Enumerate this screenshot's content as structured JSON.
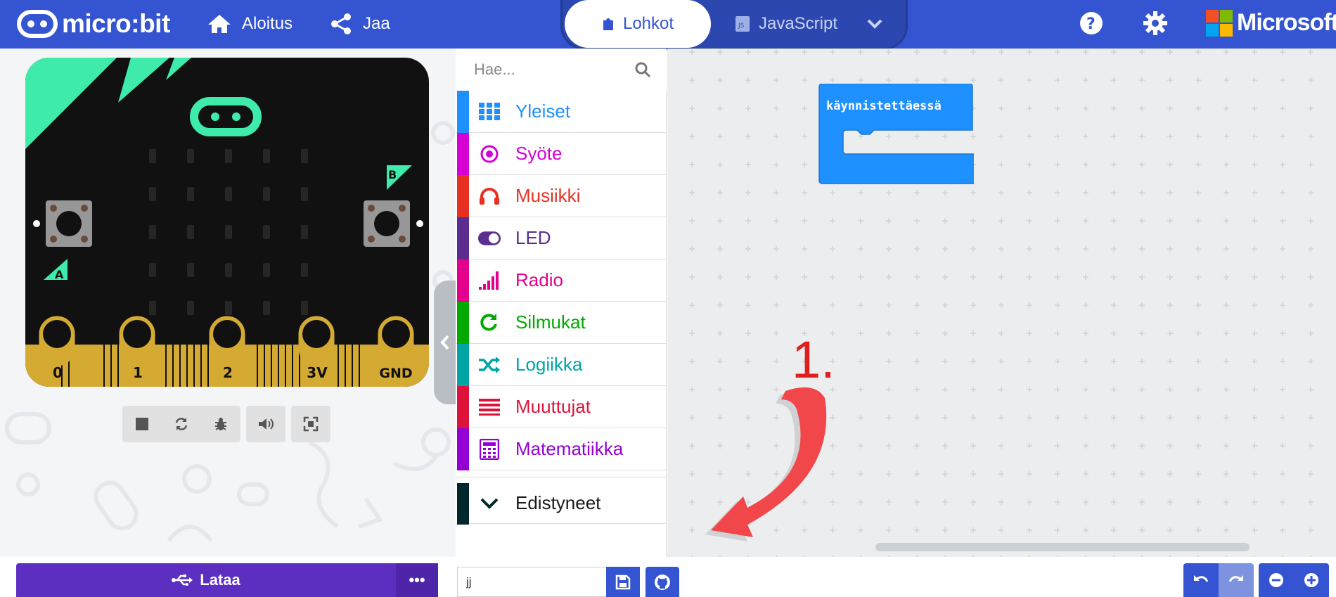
{
  "header": {
    "logo_text": "micro:bit",
    "nav": [
      {
        "label": "Aloitus",
        "icon": "home-icon"
      },
      {
        "label": "Jaa",
        "icon": "share-icon"
      }
    ],
    "modes": {
      "blocks_label": "Lohkot",
      "javascript_label": "JavaScript",
      "active": "Lohkot"
    },
    "right_icons": [
      "help-icon",
      "settings-icon"
    ],
    "brand": "Microsoft",
    "color": "#3454d1"
  },
  "simulator": {
    "pins": [
      "0",
      "1",
      "2",
      "3V",
      "GND"
    ],
    "buttons": [
      "A",
      "B"
    ],
    "controls": [
      "stop-icon",
      "restart-icon",
      "debug-icon",
      "mute-icon",
      "fullscreen-icon"
    ]
  },
  "toolbox": {
    "search_placeholder": "Hae...",
    "categories": [
      {
        "label": "Yleiset",
        "color": "#1e90ff",
        "icon": "grid-icon"
      },
      {
        "label": "Syöte",
        "color": "#d400d4",
        "icon": "target-icon"
      },
      {
        "label": "Musiikki",
        "color": "#e63022",
        "icon": "headphones-icon"
      },
      {
        "label": "LED",
        "color": "#5c2d91",
        "icon": "toggle-icon"
      },
      {
        "label": "Radio",
        "color": "#e3008c",
        "icon": "signal-icon"
      },
      {
        "label": "Silmukat",
        "color": "#00aa00",
        "icon": "loop-icon"
      },
      {
        "label": "Logiikka",
        "color": "#00a4a6",
        "icon": "shuffle-icon"
      },
      {
        "label": "Muuttujat",
        "color": "#dc143c",
        "icon": "list-icon"
      },
      {
        "label": "Matematiikka",
        "color": "#9400d3",
        "icon": "calculator-icon"
      }
    ],
    "advanced": {
      "label": "Edistyneet",
      "color": "#00272b",
      "icon": "chevron-down-icon"
    }
  },
  "workspace": {
    "on_start_block": "käynnistettäessä",
    "block_color": "#1e90ff",
    "annotation_number": "1.",
    "annotation_color": "#e01e1e"
  },
  "bottom": {
    "download_label": "Lataa",
    "more_label": "•••",
    "project_name": "jj"
  }
}
